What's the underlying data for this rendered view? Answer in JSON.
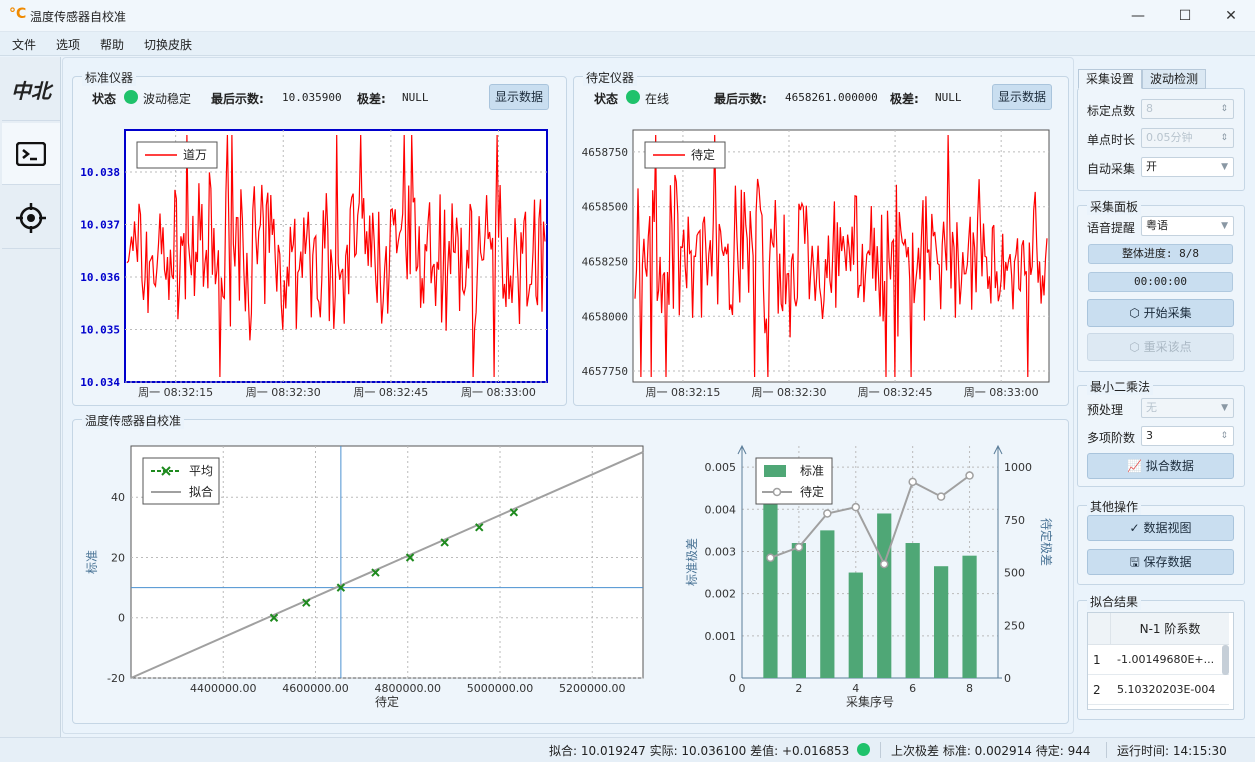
{
  "window": {
    "title": "温度传感器自校准",
    "icon": "°C",
    "min": "—",
    "max": "☐",
    "close": "✕"
  },
  "menu": [
    "文件",
    "选项",
    "帮助",
    "切换皮肤"
  ],
  "sidebar": {
    "items": [
      "中北",
      "terminal-icon",
      "target-icon"
    ]
  },
  "std_panel": {
    "title": "标准仪器",
    "status_label": "状态",
    "status_text": "波动稳定",
    "last_label": "最后示数:",
    "last_value": "10.035900",
    "range_label": "极差:",
    "range_value": "NULL",
    "button": "显示数据"
  },
  "dut_panel": {
    "title": "待定仪器",
    "status_label": "状态",
    "status_text": "在线",
    "last_label": "最后示数:",
    "last_value": "4658261.000000",
    "range_label": "极差:",
    "range_value": "NULL",
    "button": "显示数据"
  },
  "calib_panel": {
    "title": "温度传感器自校准"
  },
  "right": {
    "tabs": [
      "采集设置",
      "波动检测"
    ],
    "settings": [
      {
        "label": "标定点数",
        "value": "8",
        "disabled": true
      },
      {
        "label": "单点时长",
        "value": "0.05分钟",
        "disabled": true
      },
      {
        "label": "自动采集",
        "value": "开",
        "disabled": false
      }
    ],
    "collect": {
      "title": "采集面板",
      "voice_label": "语音提醒",
      "voice_value": "粤语",
      "progress": "整体进度: 8/8",
      "timer": "00:00:00",
      "start": "开始采集",
      "redo": "重采该点"
    },
    "lsq": {
      "title": "最小二乘法",
      "pre_label": "预处理",
      "pre_value": "无",
      "order_label": "多项阶数",
      "order_value": "3",
      "fit": "拟合数据"
    },
    "other": {
      "title": "其他操作",
      "view": "数据视图",
      "save": "保存数据"
    },
    "result": {
      "title": "拟合结果",
      "header": "N-1 阶系数",
      "rows": [
        {
          "n": "1",
          "v": "-1.00149680E+..."
        },
        {
          "n": "2",
          "v": "5.10320203E-004"
        }
      ]
    }
  },
  "status": {
    "fit": "拟合: 10.019247 实际: 10.036100 差值: +0.016853",
    "range": "上次极差 标准: 0.002914 待定: 944",
    "runtime": "运行时间: 14:15:30"
  },
  "chart_data": [
    {
      "type": "line",
      "series": [
        {
          "name": "道万"
        }
      ],
      "x_ticks": [
        "周一 08:32:15",
        "周一 08:32:30",
        "周一 08:32:45",
        "周一 08:33:00"
      ],
      "y_ticks": [
        "10.034",
        "10.035",
        "10.036",
        "10.037",
        "10.038"
      ],
      "ylim": [
        10.034,
        10.0388
      ]
    },
    {
      "type": "line",
      "series": [
        {
          "name": "待定"
        }
      ],
      "x_ticks": [
        "周一 08:32:15",
        "周一 08:32:30",
        "周一 08:32:45",
        "周一 08:33:00"
      ],
      "y_ticks": [
        "4657750",
        "4658000",
        "4658250",
        "4658500",
        "4658750"
      ],
      "ylim": [
        4657700,
        4658850
      ]
    },
    {
      "type": "scatter",
      "xlabel": "待定",
      "ylabel": "标准",
      "x_ticks": [
        "4400000.00",
        "4600000.00",
        "4800000.00",
        "5000000.00",
        "5200000.00"
      ],
      "y_ticks": [
        "-20",
        "0",
        "20",
        "40"
      ],
      "xlim": [
        4200000,
        5310000
      ],
      "ylim": [
        -20,
        57
      ],
      "series": [
        {
          "name": "平均",
          "x": [
            4510000,
            4580000,
            4655000,
            4730000,
            4805000,
            4880000,
            4955000,
            5030000
          ],
          "y": [
            0,
            5,
            10,
            15,
            20,
            25,
            30,
            35
          ]
        },
        {
          "name": "拟合",
          "x": [
            4200000,
            5310000
          ],
          "y": [
            -21,
            55
          ]
        }
      ],
      "crosshair": {
        "x": 4655000,
        "y": 10
      }
    },
    {
      "type": "bar",
      "xlabel": "采集序号",
      "ylabel": "标准极差",
      "y2label": "待定极差",
      "x": [
        1,
        2,
        3,
        4,
        5,
        6,
        7,
        8
      ],
      "x_ticks": [
        "0",
        "2",
        "4",
        "6",
        "8"
      ],
      "y_ticks": [
        "0",
        "0.001",
        "0.002",
        "0.003",
        "0.004",
        "0.005"
      ],
      "y2_ticks": [
        "0",
        "250",
        "500",
        "750",
        "1000"
      ],
      "ylim": [
        0,
        0.0055
      ],
      "y2lim": [
        0,
        1100
      ],
      "xlim": [
        0,
        9
      ],
      "series": [
        {
          "name": "标准",
          "values": [
            0.0047,
            0.0032,
            0.0035,
            0.0025,
            0.0039,
            0.0032,
            0.00265,
            0.0029
          ]
        },
        {
          "name": "待定",
          "values": [
            570,
            620,
            780,
            810,
            540,
            930,
            860,
            960
          ]
        }
      ]
    }
  ],
  "colors": {
    "accent": "#1fc26b",
    "line": "#ff0000",
    "bar": "#4fa776",
    "fit": "#a0a0a0",
    "avg": "#1e8a1e",
    "axis_blue": "#0000cc"
  }
}
